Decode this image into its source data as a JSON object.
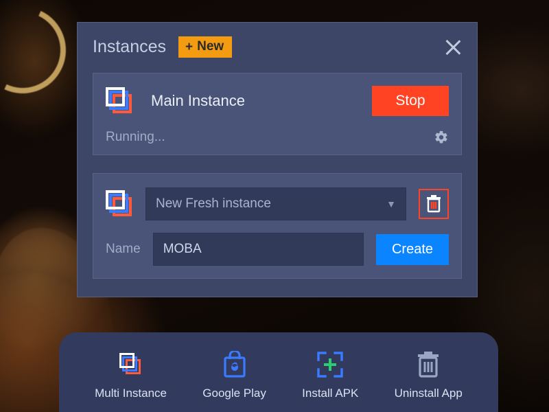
{
  "panel": {
    "title": "Instances",
    "new_label": "New"
  },
  "main_instance": {
    "name": "Main Instance",
    "stop_label": "Stop",
    "status": "Running..."
  },
  "new_instance": {
    "dropdown_value": "New Fresh instance",
    "name_label": "Name",
    "name_value": "MOBA",
    "create_label": "Create"
  },
  "dock": {
    "multi": "Multi Instance",
    "play": "Google Play",
    "apk": "Install APK",
    "uninstall": "Uninstall App"
  }
}
